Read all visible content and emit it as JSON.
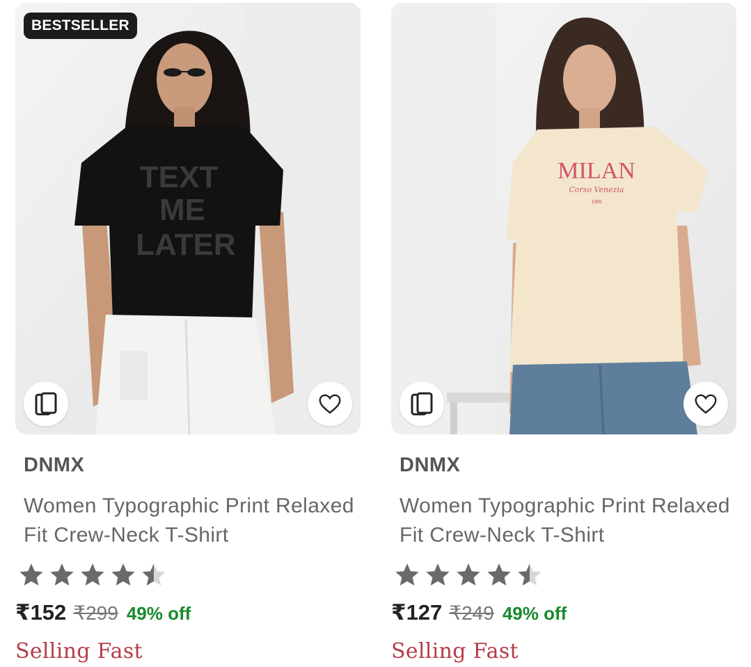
{
  "products": [
    {
      "badge": "BESTSELLER",
      "brand": "DNMX",
      "title": "Women Typographic Print Relaxed Fit Crew-Neck T-Shirt",
      "rating": 4.5,
      "price": "₹152",
      "mrp": "₹299",
      "discount": "49% off",
      "status": "Selling Fast",
      "print_text": [
        "TEXT",
        "ME",
        "LATER"
      ],
      "shirt_color": "#121212",
      "bottom_color": "#f3f3f1",
      "icons": {
        "similar": "similar-products-icon",
        "wishlist": "heart-icon"
      }
    },
    {
      "badge": "",
      "brand": "DNMX",
      "title": "Women Typographic Print Relaxed Fit Crew-Neck T-Shirt",
      "rating": 4.5,
      "price": "₹127",
      "mrp": "₹249",
      "discount": "49% off",
      "status": "Selling Fast",
      "print_text": [
        "MILAN",
        "Corso Venezia",
        "1985"
      ],
      "shirt_color": "#f3e6cd",
      "bottom_color": "#5f7e9c",
      "icons": {
        "similar": "similar-products-icon",
        "wishlist": "heart-icon"
      }
    }
  ],
  "colors": {
    "star": "#6a6a6a",
    "star_empty": "#d6d6d6",
    "discount": "#178a2c",
    "status": "#b53c48",
    "badge_bg": "#1c1c1c"
  }
}
